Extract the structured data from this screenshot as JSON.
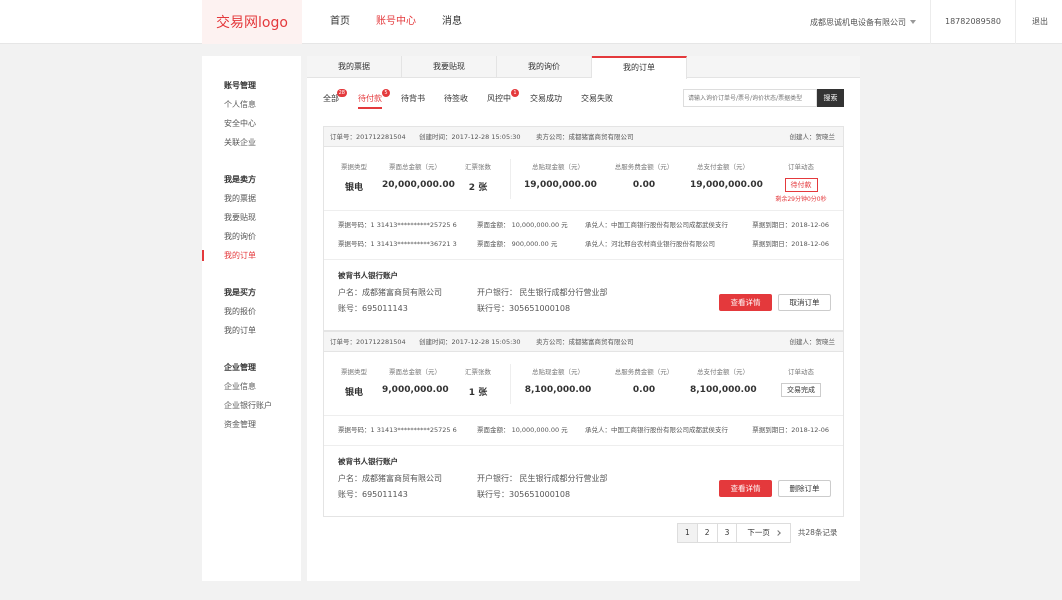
{
  "header": {
    "logo": "交易网logo",
    "nav": [
      "首页",
      "账号中心",
      "消息"
    ],
    "company": "成都思诚机电设备有限公司",
    "phone": "18782089580",
    "logout": "退出"
  },
  "sidebar": {
    "groups": [
      {
        "title": "账号管理",
        "items": [
          "个人信息",
          "安全中心",
          "关联企业"
        ]
      },
      {
        "title": "我是卖方",
        "items": [
          "我的票据",
          "我要贴现",
          "我的询价",
          "我的订单"
        ]
      },
      {
        "title": "我是买方",
        "items": [
          "我的报价",
          "我的订单"
        ]
      },
      {
        "title": "企业管理",
        "items": [
          "企业信息",
          "企业银行账户",
          "资金管理"
        ]
      }
    ]
  },
  "tabs": [
    "我的票据",
    "我要贴现",
    "我的询价",
    "我的订单"
  ],
  "subtabs": [
    {
      "label": "全部",
      "badge": "28"
    },
    {
      "label": "待付款",
      "badge": "5"
    },
    {
      "label": "待背书",
      "badge": ""
    },
    {
      "label": "待签收",
      "badge": ""
    },
    {
      "label": "风控中",
      "badge": "1"
    },
    {
      "label": "交易成功",
      "badge": ""
    },
    {
      "label": "交易失败",
      "badge": ""
    }
  ],
  "search": {
    "placeholder": "请输入询价订单号/票号/询价状态/票据类型",
    "button": "搜索"
  },
  "summary_labels": [
    "票据类型",
    "票面总金额（元）",
    "汇票张数",
    "总贴现金额（元）",
    "总服务费金额（元）",
    "总支付金额（元）",
    "订单动态"
  ],
  "orders": [
    {
      "order_no": "订单号：201712281504",
      "created": "创建时间：2017-12-28  15:05:30",
      "seller": "卖方公司：成都猪富商贸有限公司",
      "creator": "创建人：贺晓兰",
      "type": "银电",
      "face_total": "20,000,000.00",
      "count": "2 张",
      "discount_total": "19,000,000.00",
      "service_total": "0.00",
      "pay_total": "19,000,000.00",
      "status": "待付款",
      "countdown": "剩余29分钟0分0秒",
      "bills": [
        {
          "no": "票据号码：1 31413**********25725 6",
          "amount": "票面金额：  10,000,000.00   元",
          "acceptor": "承兑人：中国工商银行股份有限公司成都武侯支行",
          "due": "票据到期日：2018-12-06"
        },
        {
          "no": "票据号码：1 31413**********36721 3",
          "amount": "票面金额：  900,000.00   元",
          "acceptor": "承兑人：河北邢台农村商业银行股份有限公司",
          "due": "票据到期日：2018-12-06"
        }
      ],
      "endorse_title": "被背书人银行账户",
      "account_name": "户名：成都猪富商贸有限公司",
      "account_no": "账号：695011143",
      "bank": "开户银行：  民生银行成都分行营业部",
      "bank_code": "联行号：305651000108",
      "btn_detail": "查看详情",
      "btn_action": "取消订单"
    },
    {
      "order_no": "订单号：201712281504",
      "created": "创建时间：2017-12-28  15:05:30",
      "seller": "卖方公司：成都猪富商贸有限公司",
      "creator": "创建人：贺晓兰",
      "type": "银电",
      "face_total": "9,000,000.00",
      "count": "1 张",
      "discount_total": "8,100,000.00",
      "service_total": "0.00",
      "pay_total": "8,100,000.00",
      "status": "交易完成",
      "bills": [
        {
          "no": "票据号码：1 31413**********25725 6",
          "amount": "票面金额：  10,000,000.00   元",
          "acceptor": "承兑人：中国工商银行股份有限公司成都武侯支行",
          "due": "票据到期日：2018-12-06"
        }
      ],
      "endorse_title": "被背书人银行账户",
      "account_name": "户名：成都猪富商贸有限公司",
      "account_no": "账号：695011143",
      "bank": "开户银行：  民生银行成都分行营业部",
      "bank_code": "联行号：305651000108",
      "btn_detail": "查看详情",
      "btn_action": "删除订单"
    }
  ],
  "pagination": {
    "pages": [
      "1",
      "2",
      "3"
    ],
    "next": "下一页",
    "total": "共28条记录"
  },
  "colors": {
    "accent": "#e4393c"
  }
}
